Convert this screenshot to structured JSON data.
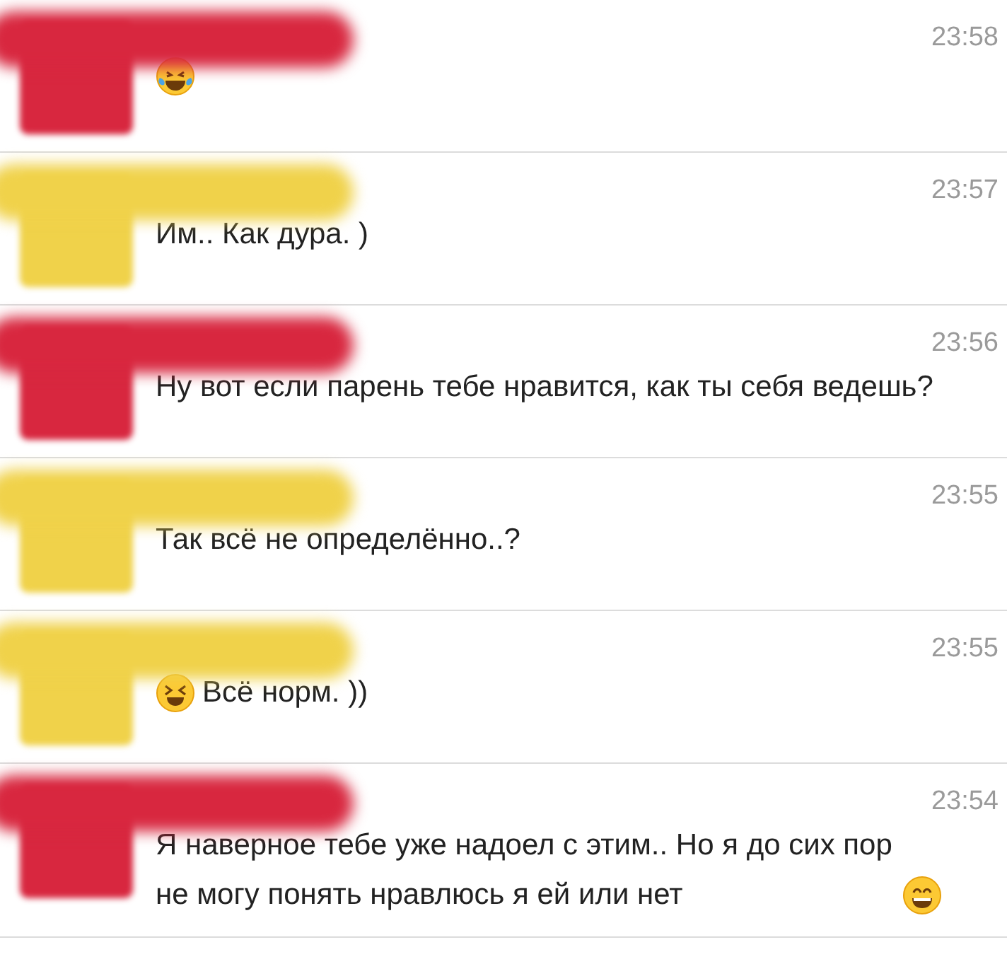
{
  "messages": [
    {
      "color": "#d8273f",
      "time": "23:58",
      "segments": [
        {
          "kind": "tears-emoji"
        }
      ]
    },
    {
      "color": "#f0d24a",
      "time": "23:57",
      "segments": [
        {
          "kind": "text",
          "text": "Им.. Как дура. )"
        }
      ]
    },
    {
      "color": "#d8273f",
      "time": "23:56",
      "segments": [
        {
          "kind": "text",
          "text": "Ну вот если парень тебе нравится, как ты себя ведешь?"
        }
      ]
    },
    {
      "color": "#f0d24a",
      "time": "23:55",
      "segments": [
        {
          "kind": "text",
          "text": "Так всё не определённо..?"
        }
      ]
    },
    {
      "color": "#f0d24a",
      "time": "23:55",
      "segments": [
        {
          "kind": "squint-emoji"
        },
        {
          "kind": "text",
          "text": " Всё норм. ))"
        }
      ]
    },
    {
      "color": "#d8273f",
      "time": "23:54",
      "segments": [
        {
          "kind": "text",
          "text": "Я наверное тебе уже надоел с этим.. Но я до сих пор не могу понять нравлюсь я ей или нет"
        },
        {
          "kind": "grin-emoji"
        }
      ]
    }
  ]
}
